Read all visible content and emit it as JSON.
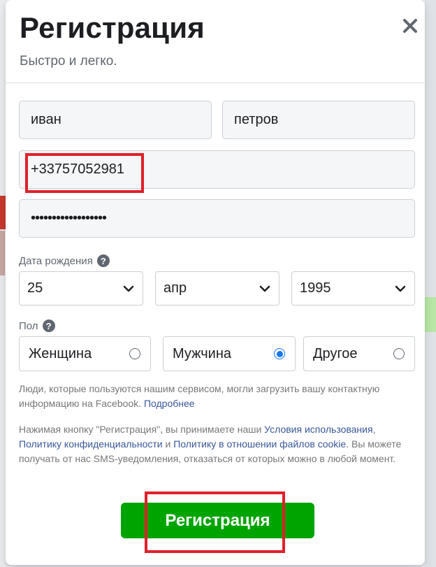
{
  "colors": {
    "accent_green": "#00a400",
    "link": "#385898",
    "radio_selected": "#1877f2",
    "highlight": "#e0202a",
    "arrow": "#c7392d"
  },
  "header": {
    "title": "Регистрация",
    "subtitle": "Быстро и легко.",
    "close_icon": "close-icon"
  },
  "form": {
    "first_name": "иван",
    "last_name": "петров",
    "phone": "+33757052981",
    "password_masked": "••••••••••••••••••",
    "birthday": {
      "label": "Дата рождения",
      "help_icon": "?",
      "day": "25",
      "month": "апр",
      "year": "1995"
    },
    "gender": {
      "label": "Пол",
      "help_icon": "?",
      "options": [
        {
          "label": "Женщина",
          "selected": false
        },
        {
          "label": "Мужчина",
          "selected": true
        },
        {
          "label": "Другое",
          "selected": false
        }
      ]
    }
  },
  "notes": {
    "contacts_text": "Люди, которые пользуются нашим сервисом, могли загрузить вашу контактную информацию на Facebook.",
    "contacts_link": "Подробнее",
    "terms_prefix": "Нажимая кнопку \"Регистрация\", вы принимаете наши",
    "terms_link": "Условия использования",
    "privacy_link": "Политику конфиденциальности",
    "and": "и",
    "cookie_link": "Политику в отношении файлов cookie",
    "terms_suffix": ". Вы можете получать от нас SMS-уведомления, отказаться от которых можно в любой момент."
  },
  "submit_label": "Регистрация"
}
